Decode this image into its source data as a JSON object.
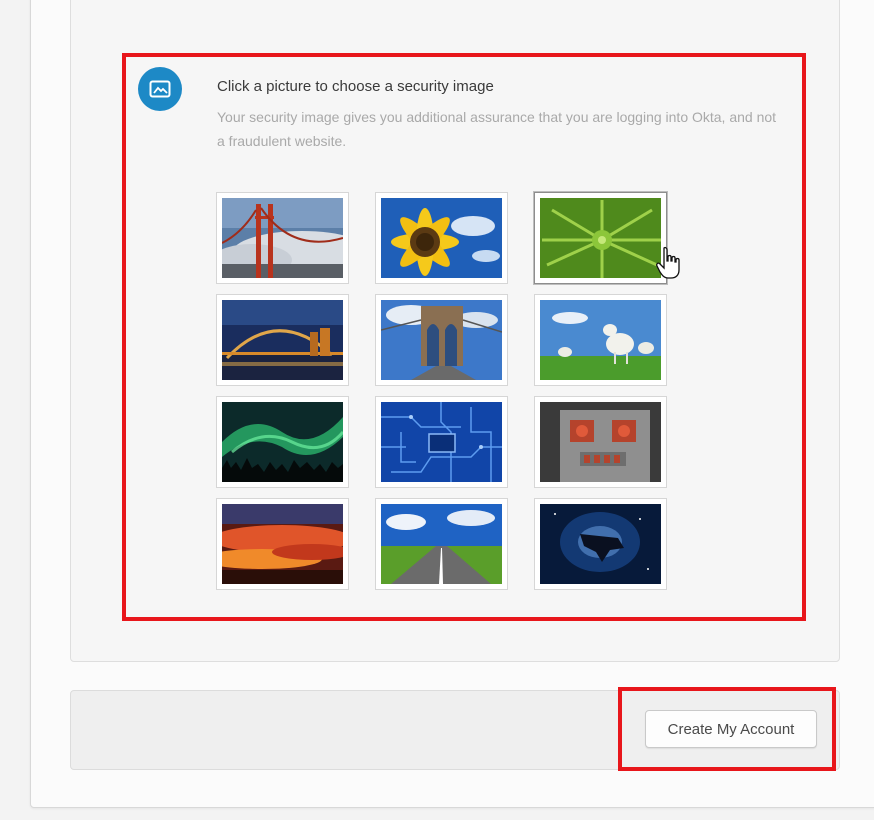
{
  "security_image": {
    "title": "Click a picture to choose a security image",
    "description": "Your security image gives you additional assurance that you are logging into Okta, and not a fraudulent website.",
    "images": [
      {
        "name": "golden-gate-bridge"
      },
      {
        "name": "sunflower"
      },
      {
        "name": "succulent-plant"
      },
      {
        "name": "harbour-bridge-night"
      },
      {
        "name": "brooklyn-bridge"
      },
      {
        "name": "lambs-on-grass"
      },
      {
        "name": "aurora-borealis"
      },
      {
        "name": "circuit-board"
      },
      {
        "name": "toy-robot"
      },
      {
        "name": "sunset-clouds"
      },
      {
        "name": "open-road"
      },
      {
        "name": "space-object"
      }
    ]
  },
  "footer": {
    "create_account_label": "Create My Account"
  },
  "colors": {
    "highlight": "#e8161b",
    "icon_accent": "#1d89c6"
  }
}
